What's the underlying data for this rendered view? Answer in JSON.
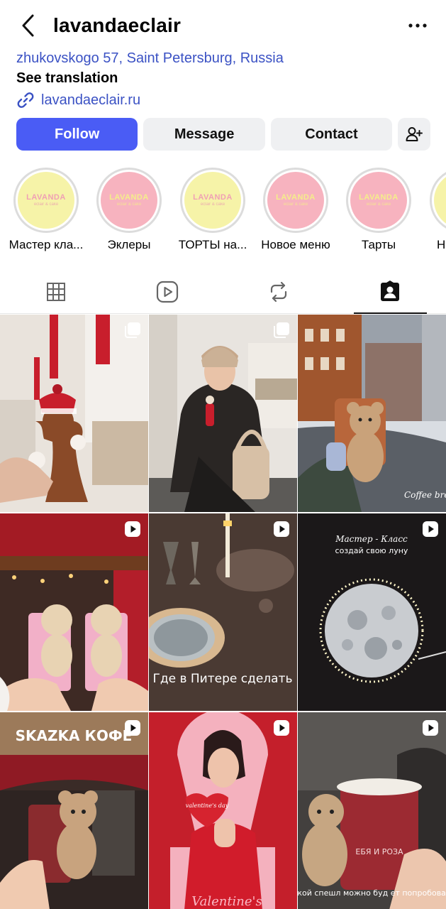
{
  "header": {
    "username": "lavandaeclair"
  },
  "bio": {
    "address": "zhukovskogo 57, Saint Petersburg, Russia",
    "see_translation": "See translation",
    "website": "lavandaeclair.ru"
  },
  "actions": {
    "follow": "Follow",
    "message": "Message",
    "contact": "Contact"
  },
  "colors": {
    "follow_button": "#4a5cf5",
    "link": "#3b52c4",
    "secondary_button": "#eff0f2"
  },
  "highlights": [
    {
      "label": "Мастер кла...",
      "brand": "LAVANDA",
      "sub": "eclair & cake",
      "bg": "#f6f3a8"
    },
    {
      "label": "Эклеры",
      "brand": "LAVANDA",
      "sub": "eclair & cake",
      "bg": "#f7b3bf"
    },
    {
      "label": "ТОРТЫ на...",
      "brand": "LAVANDA",
      "sub": "eclair & cake",
      "bg": "#f6f3a8"
    },
    {
      "label": "Новое меню",
      "brand": "LAVANDA",
      "sub": "eclair & cake",
      "bg": "#f7b3bf"
    },
    {
      "label": "Тарты",
      "brand": "LAVANDA",
      "sub": "eclair & cake",
      "bg": "#f7b3bf"
    },
    {
      "label": "Н",
      "brand": "",
      "sub": "",
      "bg": "#f6f3a8"
    }
  ],
  "tabs": [
    {
      "name": "grid-icon",
      "active": false
    },
    {
      "name": "reels-icon",
      "active": false
    },
    {
      "name": "reposts-icon",
      "active": false
    },
    {
      "name": "tagged-icon",
      "active": true
    }
  ],
  "posts": [
    {
      "type": "carousel",
      "icon": "carousel-icon"
    },
    {
      "type": "carousel",
      "icon": "carousel-icon"
    },
    {
      "type": "photo",
      "caption": "Coffee break"
    },
    {
      "type": "reel",
      "icon": "reel-icon"
    },
    {
      "type": "reel",
      "icon": "reel-icon",
      "caption": "Где в Питере сделать"
    },
    {
      "type": "reel",
      "icon": "reel-icon",
      "caption_top": "Мастер - Класс",
      "caption_main": "создай свою луну"
    },
    {
      "type": "reel",
      "icon": "reel-icon",
      "sign": "SKAZKA КОФЕ"
    },
    {
      "type": "reel",
      "icon": "reel-icon",
      "heart_text": "valentine's day",
      "caption": "Valentine's"
    },
    {
      "type": "reel",
      "icon": "reel-icon",
      "cup_text": "ЕБЯ И РОЗА",
      "caption": "такой спешл можно буд ет попробовать"
    }
  ]
}
